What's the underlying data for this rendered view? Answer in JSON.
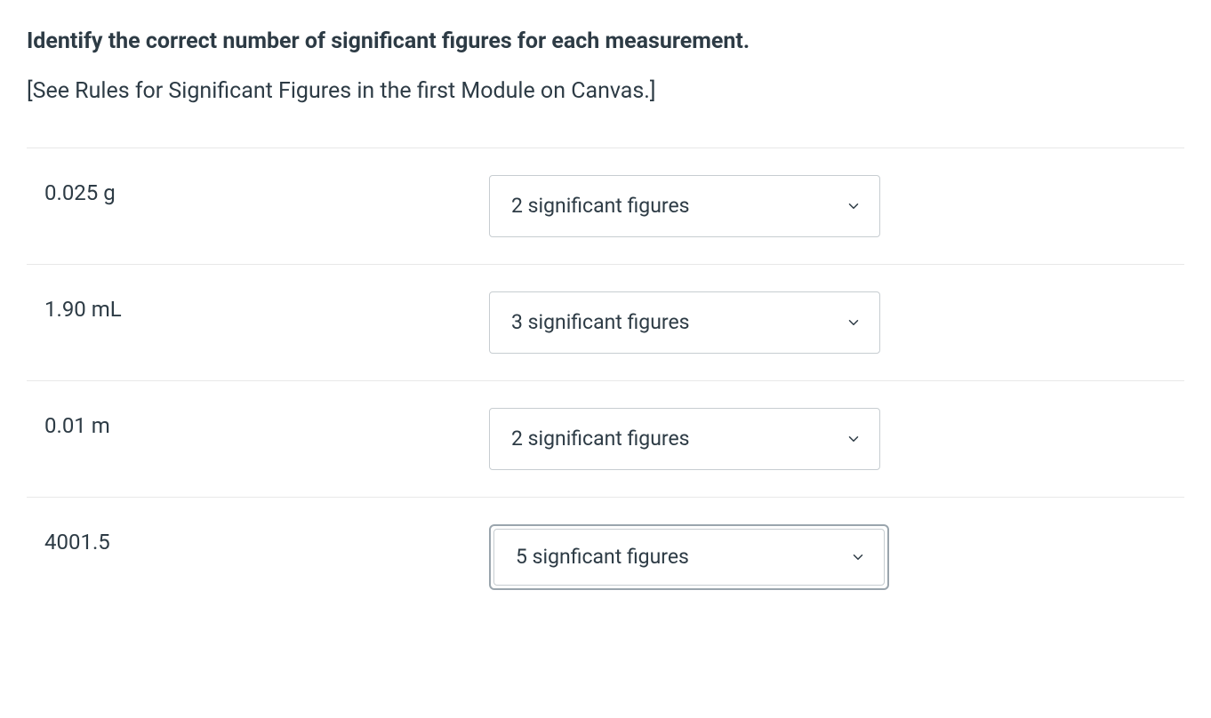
{
  "prompt": {
    "title": "Identify the correct number of significant figures for each measurement.",
    "subtext": "[See Rules for Significant Figures in the first Module on Canvas.]"
  },
  "rows": [
    {
      "measurement": "0.025 g",
      "selected": "2 significant figures",
      "focused": false
    },
    {
      "measurement": "1.90 mL",
      "selected": "3 significant figures",
      "focused": false
    },
    {
      "measurement": "0.01 m",
      "selected": "2 significant figures",
      "focused": false
    },
    {
      "measurement": "4001.5",
      "selected": "5 signficant figures",
      "focused": true
    }
  ]
}
